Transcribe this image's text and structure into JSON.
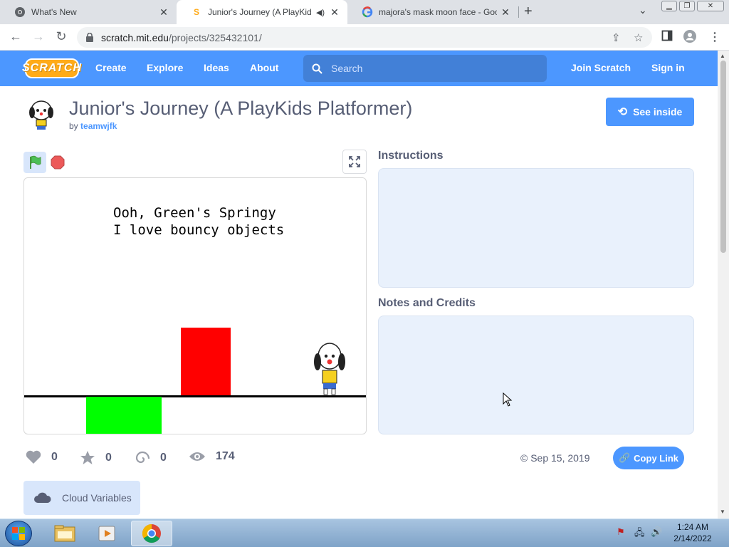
{
  "browser": {
    "tabs": [
      {
        "title": "What's New"
      },
      {
        "title": "Junior's Journey (A PlayKids Platformer)"
      },
      {
        "title": "majora's mask moon face - Google Search"
      }
    ],
    "new_tab": "+",
    "url_host": "scratch.mit.edu",
    "url_path": "/projects/325432101/"
  },
  "scratch": {
    "logo": "SCRATCH",
    "nav": [
      "Create",
      "Explore",
      "Ideas",
      "About"
    ],
    "search_placeholder": "Search",
    "join": "Join Scratch",
    "signin": "Sign in"
  },
  "project": {
    "title": "Junior's Journey (A PlayKids Platformer)",
    "by": "by",
    "author": "teamwjfk",
    "see_inside": "See inside",
    "say_text": "Ooh, Green's Springy\nI love bouncy objects",
    "instructions_label": "Instructions",
    "notes_label": "Notes and Credits",
    "loves": "0",
    "favorites": "0",
    "remixes": "0",
    "views": "174",
    "date": "© Sep 15, 2019",
    "copy_link": "Copy Link",
    "cloud_variables": "Cloud Variables"
  },
  "taskbar": {
    "time": "1:24 AM",
    "date": "2/14/2022"
  },
  "colors": {
    "scratch_blue": "#4c97ff",
    "panel_bg": "#e9f1fc",
    "green_block": "#00ff00",
    "red_block": "#ff0000"
  }
}
